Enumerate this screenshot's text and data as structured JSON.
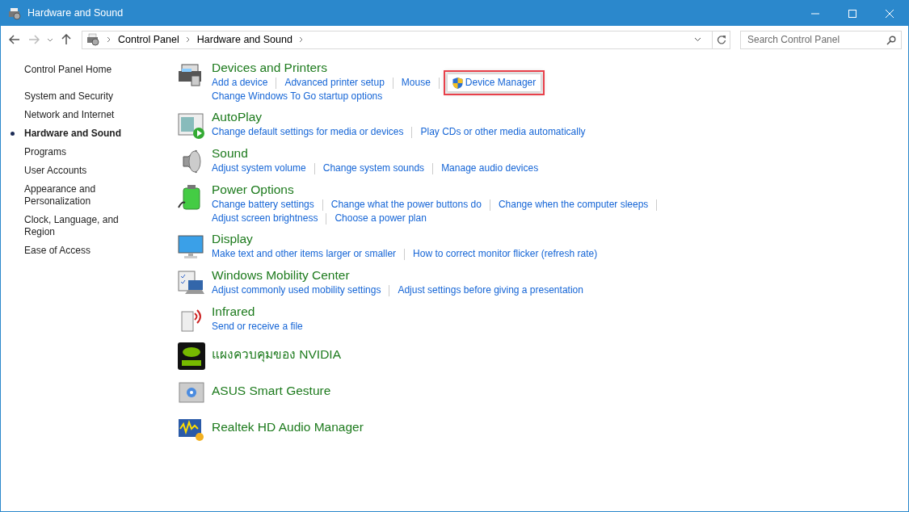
{
  "window": {
    "title": "Hardware and Sound"
  },
  "address_bar": {
    "breadcrumbs": [
      "Control Panel",
      "Hardware and Sound"
    ]
  },
  "search": {
    "placeholder": "Search Control Panel"
  },
  "sidebar": {
    "home": "Control Panel Home",
    "items": [
      {
        "label": "System and Security",
        "selected": false
      },
      {
        "label": "Network and Internet",
        "selected": false
      },
      {
        "label": "Hardware and Sound",
        "selected": true
      },
      {
        "label": "Programs",
        "selected": false
      },
      {
        "label": "User Accounts",
        "selected": false
      },
      {
        "label": "Appearance and Personalization",
        "selected": false
      },
      {
        "label": "Clock, Language, and Region",
        "selected": false
      },
      {
        "label": "Ease of Access",
        "selected": false
      }
    ]
  },
  "categories": [
    {
      "title": "Devices and Printers",
      "link_rows": [
        [
          {
            "label": "Add a device"
          },
          {
            "label": "Advanced printer setup"
          },
          {
            "label": "Mouse"
          },
          {
            "label": "Device Manager",
            "shield": true,
            "highlighted": true
          }
        ],
        [
          {
            "label": "Change Windows To Go startup options"
          }
        ]
      ]
    },
    {
      "title": "AutoPlay",
      "link_rows": [
        [
          {
            "label": "Change default settings for media or devices"
          },
          {
            "label": "Play CDs or other media automatically"
          }
        ]
      ]
    },
    {
      "title": "Sound",
      "link_rows": [
        [
          {
            "label": "Adjust system volume"
          },
          {
            "label": "Change system sounds"
          },
          {
            "label": "Manage audio devices"
          }
        ]
      ]
    },
    {
      "title": "Power Options",
      "link_rows": [
        [
          {
            "label": "Change battery settings"
          },
          {
            "label": "Change what the power buttons do"
          },
          {
            "label": "Change when the computer sleeps"
          }
        ],
        [
          {
            "label": "Adjust screen brightness"
          },
          {
            "label": "Choose a power plan"
          }
        ]
      ]
    },
    {
      "title": "Display",
      "link_rows": [
        [
          {
            "label": "Make text and other items larger or smaller"
          },
          {
            "label": "How to correct monitor flicker (refresh rate)"
          }
        ]
      ]
    },
    {
      "title": "Windows Mobility Center",
      "link_rows": [
        [
          {
            "label": "Adjust commonly used mobility settings"
          },
          {
            "label": "Adjust settings before giving a presentation"
          }
        ]
      ]
    },
    {
      "title": "Infrared",
      "link_rows": [
        [
          {
            "label": "Send or receive a file"
          }
        ]
      ]
    },
    {
      "title": "แผงควบคุมของ NVIDIA"
    },
    {
      "title": "ASUS Smart Gesture"
    },
    {
      "title": "Realtek HD Audio Manager"
    }
  ]
}
